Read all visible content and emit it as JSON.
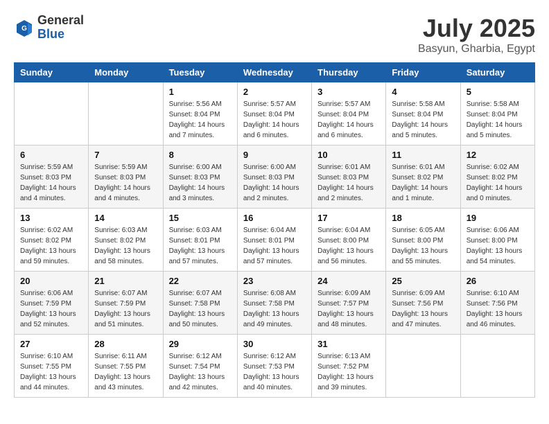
{
  "header": {
    "logo_general": "General",
    "logo_blue": "Blue",
    "month_year": "July 2025",
    "location": "Basyun, Gharbia, Egypt"
  },
  "weekdays": [
    "Sunday",
    "Monday",
    "Tuesday",
    "Wednesday",
    "Thursday",
    "Friday",
    "Saturday"
  ],
  "weeks": [
    [
      {
        "day": "",
        "info": ""
      },
      {
        "day": "",
        "info": ""
      },
      {
        "day": "1",
        "info": "Sunrise: 5:56 AM\nSunset: 8:04 PM\nDaylight: 14 hours and 7 minutes."
      },
      {
        "day": "2",
        "info": "Sunrise: 5:57 AM\nSunset: 8:04 PM\nDaylight: 14 hours and 6 minutes."
      },
      {
        "day": "3",
        "info": "Sunrise: 5:57 AM\nSunset: 8:04 PM\nDaylight: 14 hours and 6 minutes."
      },
      {
        "day": "4",
        "info": "Sunrise: 5:58 AM\nSunset: 8:04 PM\nDaylight: 14 hours and 5 minutes."
      },
      {
        "day": "5",
        "info": "Sunrise: 5:58 AM\nSunset: 8:04 PM\nDaylight: 14 hours and 5 minutes."
      }
    ],
    [
      {
        "day": "6",
        "info": "Sunrise: 5:59 AM\nSunset: 8:03 PM\nDaylight: 14 hours and 4 minutes."
      },
      {
        "day": "7",
        "info": "Sunrise: 5:59 AM\nSunset: 8:03 PM\nDaylight: 14 hours and 4 minutes."
      },
      {
        "day": "8",
        "info": "Sunrise: 6:00 AM\nSunset: 8:03 PM\nDaylight: 14 hours and 3 minutes."
      },
      {
        "day": "9",
        "info": "Sunrise: 6:00 AM\nSunset: 8:03 PM\nDaylight: 14 hours and 2 minutes."
      },
      {
        "day": "10",
        "info": "Sunrise: 6:01 AM\nSunset: 8:03 PM\nDaylight: 14 hours and 2 minutes."
      },
      {
        "day": "11",
        "info": "Sunrise: 6:01 AM\nSunset: 8:02 PM\nDaylight: 14 hours and 1 minute."
      },
      {
        "day": "12",
        "info": "Sunrise: 6:02 AM\nSunset: 8:02 PM\nDaylight: 14 hours and 0 minutes."
      }
    ],
    [
      {
        "day": "13",
        "info": "Sunrise: 6:02 AM\nSunset: 8:02 PM\nDaylight: 13 hours and 59 minutes."
      },
      {
        "day": "14",
        "info": "Sunrise: 6:03 AM\nSunset: 8:02 PM\nDaylight: 13 hours and 58 minutes."
      },
      {
        "day": "15",
        "info": "Sunrise: 6:03 AM\nSunset: 8:01 PM\nDaylight: 13 hours and 57 minutes."
      },
      {
        "day": "16",
        "info": "Sunrise: 6:04 AM\nSunset: 8:01 PM\nDaylight: 13 hours and 57 minutes."
      },
      {
        "day": "17",
        "info": "Sunrise: 6:04 AM\nSunset: 8:00 PM\nDaylight: 13 hours and 56 minutes."
      },
      {
        "day": "18",
        "info": "Sunrise: 6:05 AM\nSunset: 8:00 PM\nDaylight: 13 hours and 55 minutes."
      },
      {
        "day": "19",
        "info": "Sunrise: 6:06 AM\nSunset: 8:00 PM\nDaylight: 13 hours and 54 minutes."
      }
    ],
    [
      {
        "day": "20",
        "info": "Sunrise: 6:06 AM\nSunset: 7:59 PM\nDaylight: 13 hours and 52 minutes."
      },
      {
        "day": "21",
        "info": "Sunrise: 6:07 AM\nSunset: 7:59 PM\nDaylight: 13 hours and 51 minutes."
      },
      {
        "day": "22",
        "info": "Sunrise: 6:07 AM\nSunset: 7:58 PM\nDaylight: 13 hours and 50 minutes."
      },
      {
        "day": "23",
        "info": "Sunrise: 6:08 AM\nSunset: 7:58 PM\nDaylight: 13 hours and 49 minutes."
      },
      {
        "day": "24",
        "info": "Sunrise: 6:09 AM\nSunset: 7:57 PM\nDaylight: 13 hours and 48 minutes."
      },
      {
        "day": "25",
        "info": "Sunrise: 6:09 AM\nSunset: 7:56 PM\nDaylight: 13 hours and 47 minutes."
      },
      {
        "day": "26",
        "info": "Sunrise: 6:10 AM\nSunset: 7:56 PM\nDaylight: 13 hours and 46 minutes."
      }
    ],
    [
      {
        "day": "27",
        "info": "Sunrise: 6:10 AM\nSunset: 7:55 PM\nDaylight: 13 hours and 44 minutes."
      },
      {
        "day": "28",
        "info": "Sunrise: 6:11 AM\nSunset: 7:55 PM\nDaylight: 13 hours and 43 minutes."
      },
      {
        "day": "29",
        "info": "Sunrise: 6:12 AM\nSunset: 7:54 PM\nDaylight: 13 hours and 42 minutes."
      },
      {
        "day": "30",
        "info": "Sunrise: 6:12 AM\nSunset: 7:53 PM\nDaylight: 13 hours and 40 minutes."
      },
      {
        "day": "31",
        "info": "Sunrise: 6:13 AM\nSunset: 7:52 PM\nDaylight: 13 hours and 39 minutes."
      },
      {
        "day": "",
        "info": ""
      },
      {
        "day": "",
        "info": ""
      }
    ]
  ]
}
